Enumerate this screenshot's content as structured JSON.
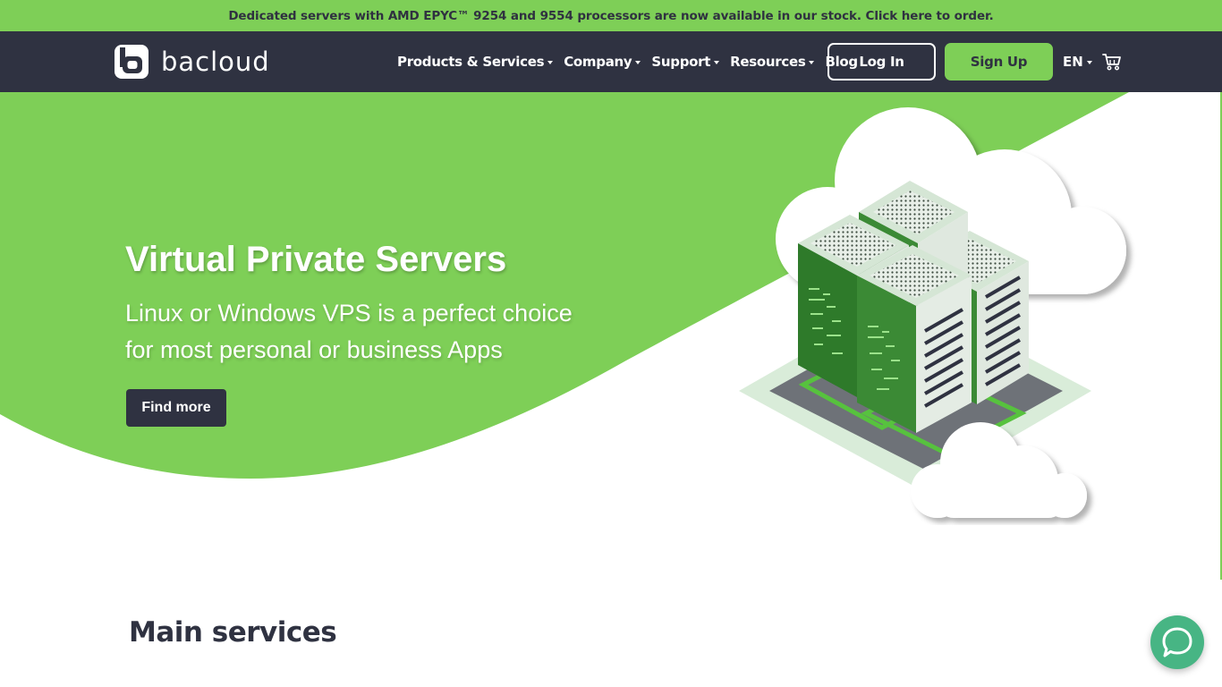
{
  "announcement": {
    "text": "Dedicated servers with AMD EPYC™ 9254 and 9554 processors are now available in our stock. Click here to order."
  },
  "navbar": {
    "logo_text": "bacloud",
    "items": [
      {
        "label": "Products & Services",
        "dropdown": true
      },
      {
        "label": "Company",
        "dropdown": true
      },
      {
        "label": "Support",
        "dropdown": true
      },
      {
        "label": "Resources",
        "dropdown": true
      },
      {
        "label": "Blog",
        "dropdown": false
      }
    ],
    "login_label": "Log In",
    "signup_label": "Sign Up",
    "language": "EN",
    "cart_icon": "cart-icon"
  },
  "hero": {
    "title": "Virtual Private Servers",
    "subtitle_line1": "Linux or Windows VPS is a perfect choice",
    "subtitle_line2": "for most personal or business Apps",
    "cta_label": "Find more"
  },
  "main": {
    "section_title": "Main services"
  },
  "chat": {
    "icon": "chat-bubble-icon"
  },
  "colors": {
    "brand_green": "#7ecf57",
    "navy": "#2f3241",
    "chat_green": "#47b584"
  }
}
